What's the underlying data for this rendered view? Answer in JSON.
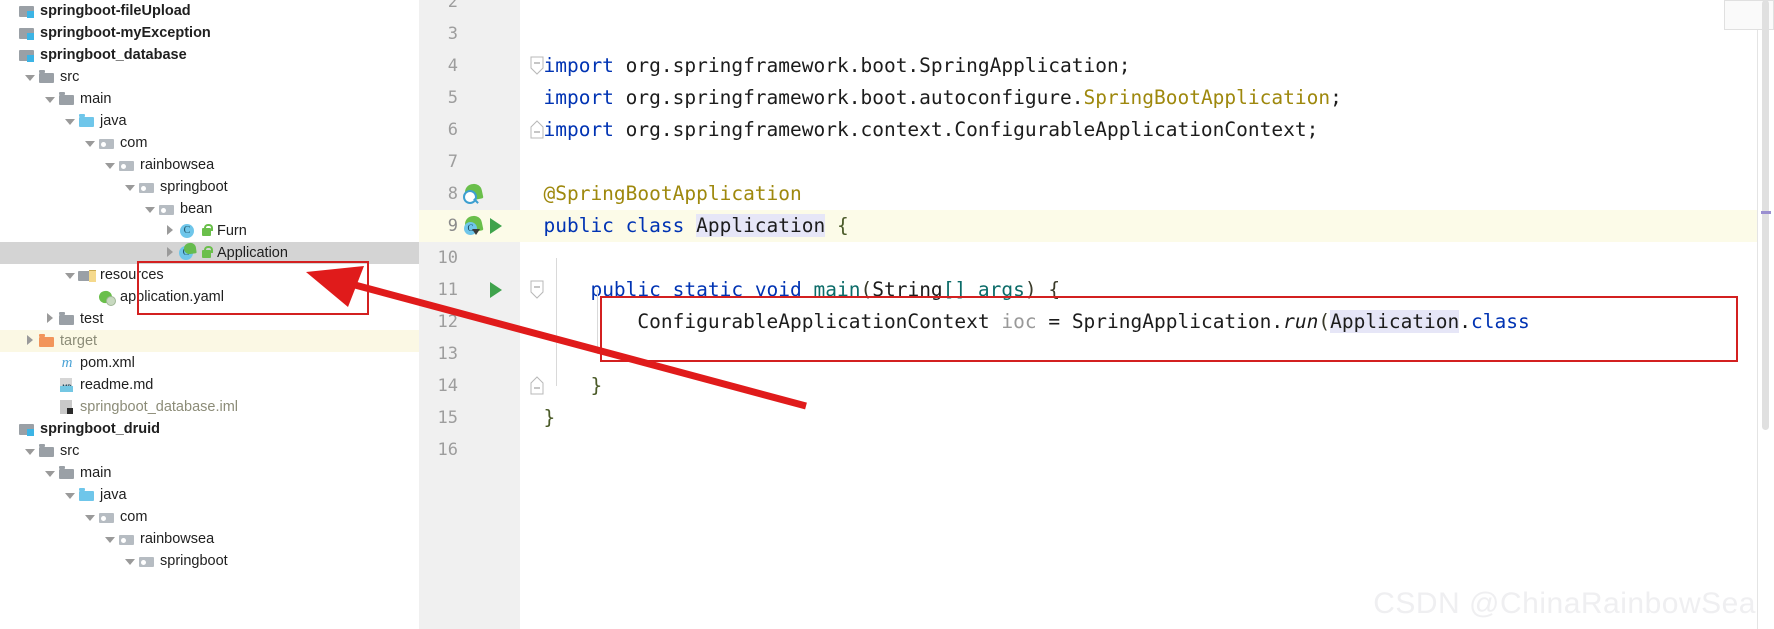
{
  "project_tree": {
    "name": "Project tool window",
    "rows": [
      {
        "label": "springboot-fileUpload",
        "indent": 0,
        "icon": "module-icon",
        "expander": "none",
        "style": "bold",
        "state": "normal"
      },
      {
        "label": "springboot-myException",
        "indent": 0,
        "icon": "module-icon",
        "expander": "none",
        "style": "bold",
        "state": "normal"
      },
      {
        "label": "springboot_database",
        "indent": 0,
        "icon": "module-icon",
        "expander": "none",
        "style": "bold",
        "state": "normal"
      },
      {
        "label": "src",
        "indent": 1,
        "icon": "folder-icon",
        "expander": "down",
        "style": "normal",
        "state": "normal"
      },
      {
        "label": "main",
        "indent": 2,
        "icon": "folder-icon",
        "expander": "down",
        "style": "normal",
        "state": "normal"
      },
      {
        "label": "java",
        "indent": 3,
        "icon": "source-folder-icon",
        "expander": "down",
        "style": "normal",
        "state": "normal"
      },
      {
        "label": "com",
        "indent": 4,
        "icon": "package-icon",
        "expander": "down",
        "style": "normal",
        "state": "normal"
      },
      {
        "label": "rainbowsea",
        "indent": 5,
        "icon": "package-icon",
        "expander": "down",
        "style": "normal",
        "state": "normal"
      },
      {
        "label": "springboot",
        "indent": 6,
        "icon": "package-icon",
        "expander": "down",
        "style": "normal",
        "state": "normal"
      },
      {
        "label": "bean",
        "indent": 7,
        "icon": "package-icon",
        "expander": "down",
        "style": "normal",
        "state": "normal"
      },
      {
        "label": "Furn",
        "indent": 8,
        "icon": "class-icon",
        "expander": "right",
        "style": "normal",
        "state": "normal",
        "lock": true
      },
      {
        "label": "Application",
        "indent": 8,
        "icon": "runnable-class-icon",
        "expander": "right",
        "style": "normal",
        "state": "selected",
        "lock": true
      },
      {
        "label": "resources",
        "indent": 3,
        "icon": "resources-folder-icon",
        "expander": "down",
        "style": "normal",
        "state": "normal"
      },
      {
        "label": "application.yaml",
        "indent": 4,
        "icon": "yaml-icon",
        "expander": "none",
        "style": "normal",
        "state": "normal"
      },
      {
        "label": "test",
        "indent": 2,
        "icon": "folder-icon",
        "expander": "right",
        "style": "normal",
        "state": "normal"
      },
      {
        "label": "target",
        "indent": 1,
        "icon": "target-folder-icon",
        "expander": "right",
        "style": "muted",
        "state": "excluded"
      },
      {
        "label": "pom.xml",
        "indent": 2,
        "icon": "maven-icon",
        "expander": "none",
        "style": "normal",
        "state": "normal"
      },
      {
        "label": "readme.md",
        "indent": 2,
        "icon": "markdown-icon",
        "expander": "none",
        "style": "normal",
        "state": "normal"
      },
      {
        "label": "springboot_database.iml",
        "indent": 2,
        "icon": "iml-icon",
        "expander": "none",
        "style": "muted",
        "state": "normal"
      },
      {
        "label": "springboot_druid",
        "indent": 0,
        "icon": "module-icon",
        "expander": "none",
        "style": "bold",
        "state": "normal"
      },
      {
        "label": "src",
        "indent": 1,
        "icon": "folder-icon",
        "expander": "down",
        "style": "normal",
        "state": "normal"
      },
      {
        "label": "main",
        "indent": 2,
        "icon": "folder-icon",
        "expander": "down",
        "style": "normal",
        "state": "normal"
      },
      {
        "label": "java",
        "indent": 3,
        "icon": "source-folder-icon",
        "expander": "down",
        "style": "normal",
        "state": "normal"
      },
      {
        "label": "com",
        "indent": 4,
        "icon": "package-icon",
        "expander": "down",
        "style": "normal",
        "state": "normal"
      },
      {
        "label": "rainbowsea",
        "indent": 5,
        "icon": "package-icon",
        "expander": "down",
        "style": "normal",
        "state": "normal"
      },
      {
        "label": "springboot",
        "indent": 6,
        "icon": "package-icon",
        "expander": "down",
        "style": "normal",
        "state": "normal"
      }
    ]
  },
  "editor": {
    "name": "Application.java editor",
    "lines": [
      {
        "num": "2",
        "gutter": [],
        "fold": "",
        "current": false,
        "tokens": []
      },
      {
        "num": "3",
        "gutter": [],
        "fold": "",
        "current": false,
        "tokens": []
      },
      {
        "num": "4",
        "gutter": [],
        "fold": "minus-down",
        "current": false,
        "tokens": [
          {
            "t": "import ",
            "c": "kw"
          },
          {
            "t": "org.springframework.boot.SpringApplication;",
            "c": "plain"
          }
        ]
      },
      {
        "num": "5",
        "gutter": [],
        "fold": "",
        "current": false,
        "tokens": [
          {
            "t": "import ",
            "c": "kw"
          },
          {
            "t": "org.springframework.boot.autoconfigure.",
            "c": "plain"
          },
          {
            "t": "SpringBootApplication",
            "c": "cls-yellow"
          },
          {
            "t": ";",
            "c": "plain"
          }
        ]
      },
      {
        "num": "6",
        "gutter": [],
        "fold": "minus-up",
        "current": false,
        "tokens": [
          {
            "t": "import ",
            "c": "kw"
          },
          {
            "t": "org.springframework.context.ConfigurableApplicationContext;",
            "c": "plain"
          }
        ]
      },
      {
        "num": "7",
        "gutter": [],
        "fold": "",
        "current": false,
        "tokens": []
      },
      {
        "num": "8",
        "gutter": [
          "spring-bean-icon"
        ],
        "fold": "",
        "current": false,
        "tokens": [
          {
            "t": "@SpringBootApplication",
            "c": "ann"
          }
        ]
      },
      {
        "num": "9",
        "gutter": [
          "spring-config-icon",
          "run-icon"
        ],
        "fold": "",
        "current": true,
        "tokens": [
          {
            "t": "public class ",
            "c": "kw"
          },
          {
            "t": "Application",
            "c": "hl"
          },
          {
            "t": " {",
            "c": "brace"
          }
        ]
      },
      {
        "num": "10",
        "gutter": [],
        "fold": "",
        "current": false,
        "tokens": []
      },
      {
        "num": "11",
        "gutter": [
          "run-icon"
        ],
        "fold": "minus-down",
        "current": false,
        "tokens": [
          {
            "t": "    ",
            "c": "plain"
          },
          {
            "t": "public static void ",
            "c": "kw"
          },
          {
            "t": "main",
            "c": "teal"
          },
          {
            "t": "(",
            "c": "paren"
          },
          {
            "t": "String",
            "c": "plain"
          },
          {
            "t": "[] args",
            "c": "teal"
          },
          {
            "t": ") {",
            "c": "paren"
          }
        ]
      },
      {
        "num": "12",
        "gutter": [],
        "fold": "",
        "current": false,
        "tokens": [
          {
            "t": "        ConfigurableApplicationContext ",
            "c": "plain"
          },
          {
            "t": "ioc",
            "c": "gray"
          },
          {
            "t": " = SpringApplication.",
            "c": "plain"
          },
          {
            "t": "run",
            "c": "ital"
          },
          {
            "t": "(",
            "c": "paren"
          },
          {
            "t": "Application",
            "c": "hl"
          },
          {
            "t": ".",
            "c": "plain"
          },
          {
            "t": "class",
            "c": "kw"
          }
        ]
      },
      {
        "num": "13",
        "gutter": [],
        "fold": "",
        "current": false,
        "tokens": []
      },
      {
        "num": "14",
        "gutter": [],
        "fold": "minus-up",
        "current": false,
        "tokens": [
          {
            "t": "    }",
            "c": "brace"
          }
        ]
      },
      {
        "num": "15",
        "gutter": [],
        "fold": "",
        "current": false,
        "tokens": [
          {
            "t": "}",
            "c": "brace"
          }
        ]
      },
      {
        "num": "16",
        "gutter": [],
        "fold": "",
        "current": false,
        "tokens": []
      }
    ]
  },
  "annotations": {
    "name": "red highlight annotations",
    "tree_box_label": "red rectangle around Application tree node",
    "editor_box_label": "red rectangle around SpringApplication.run line",
    "arrow_label": "red arrow from editor to Application tree node",
    "color": "#d32020"
  },
  "watermark": {
    "text": "CSDN @ChinaRainbowSea"
  }
}
